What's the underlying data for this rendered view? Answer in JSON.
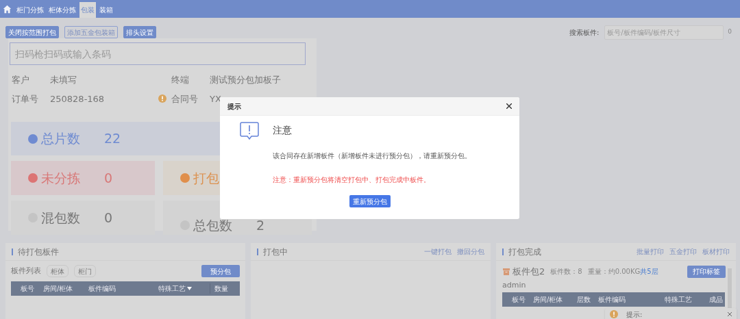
{
  "nav_tabs": [
    {
      "label": "柜门分拣",
      "selected": false
    },
    {
      "label": "柜体分拣",
      "selected": false
    },
    {
      "label": "包装",
      "selected": true
    },
    {
      "label": "装箱",
      "selected": false
    }
  ],
  "toolbar": {
    "buttons": [
      {
        "label": "关闭按范围打包",
        "kind": "filled"
      },
      {
        "label": "添加五金包装箱",
        "kind": "outline"
      },
      {
        "label": "排头设置",
        "kind": "filled"
      }
    ],
    "search_label": "搜索板件:",
    "search_placeholder": "板号/板件编码/板件尺寸",
    "search_count": "0"
  },
  "scan": {
    "placeholder": "扫码枪扫码或输入条码"
  },
  "info": [
    {
      "label": "客户",
      "value": "未填写"
    },
    {
      "label": "终端",
      "value": "测试预分包加板子"
    },
    {
      "label": "订单号",
      "value": "250828-168",
      "warning": true
    },
    {
      "label": "合同号",
      "value": "YX"
    }
  ],
  "stats": [
    {
      "label": "总片数",
      "value": "22",
      "color": "#6f8bd1",
      "kind": "wide"
    },
    {
      "label": "未分拣",
      "value": "0",
      "color": "#dc7474",
      "kind": "half"
    },
    {
      "label": "打包",
      "color": "#e08f4c",
      "kind": "half"
    },
    {
      "label": "混包数",
      "value": "0",
      "color": "#c4c4c4",
      "kind": "half"
    },
    {
      "label": "总包数",
      "value": "2",
      "color": "#c4c4c4",
      "kind": "half"
    }
  ],
  "pending_panel": {
    "title": "待打包板件",
    "list_label": "板件列表",
    "filters": [
      "柜体",
      "柜门"
    ],
    "action": "预分包",
    "columns": [
      "板号",
      "房间/柜体",
      "板件编码",
      "特殊工艺",
      "数量"
    ]
  },
  "packing_panel": {
    "title": "打包中",
    "links": [
      "一键打包",
      "撤回分包"
    ]
  },
  "done_panel": {
    "title": "打包完成",
    "links": [
      "批量打印",
      "五金打印",
      "板材打印"
    ],
    "package": {
      "name": "板件包2",
      "count": "板件数：8",
      "weight": "重量：约0.00KG",
      "layers": "共5层",
      "action": "打印标签",
      "user": "admin",
      "columns": [
        "板号",
        "房间/柜体",
        "层数",
        "板件编码",
        "特殊工艺",
        "成品"
      ]
    }
  },
  "toast": {
    "title": "提示:"
  },
  "dialog": {
    "title": "提示",
    "heading": "注意",
    "message": "该合同存在新增板件（新增板件未进行预分包），请重新预分包。",
    "warning": "注意：重新预分包将清空打包中、打包完成中板件。",
    "button": "重新预分包"
  }
}
